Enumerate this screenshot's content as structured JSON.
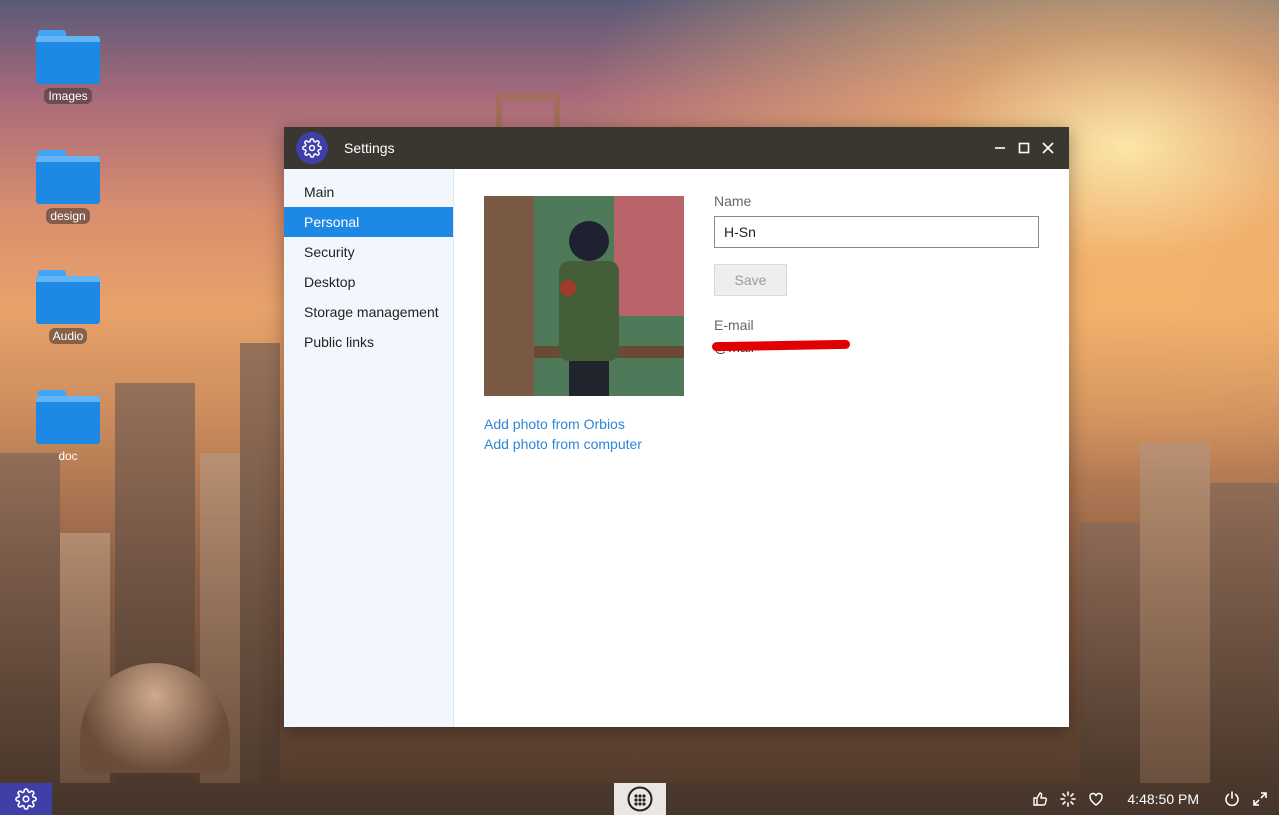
{
  "desktop": {
    "icons": [
      {
        "label": "Images"
      },
      {
        "label": "design"
      },
      {
        "label": "Audio"
      },
      {
        "label": "doc"
      }
    ]
  },
  "window": {
    "title": "Settings",
    "icon": "gear-icon",
    "controls": [
      "minimize-icon",
      "maximize-icon",
      "close-icon"
    ]
  },
  "sidebar": {
    "items": [
      {
        "label": "Main",
        "active": false
      },
      {
        "label": "Personal",
        "active": true
      },
      {
        "label": "Security",
        "active": false
      },
      {
        "label": "Desktop",
        "active": false
      },
      {
        "label": "Storage management",
        "active": false
      },
      {
        "label": "Public links",
        "active": false
      }
    ]
  },
  "profile": {
    "add_photo_orbios": "Add photo from Orbios",
    "add_photo_computer": "Add photo from computer",
    "name_label": "Name",
    "name_value": "H-Sn",
    "save_label": "Save",
    "email_label": "E-mail",
    "email_value": "@mail"
  },
  "taskbar": {
    "clock": "4:48:50 PM",
    "tray_icons": [
      "thumbs-up-icon",
      "spinner-icon",
      "heart-icon"
    ],
    "accent": "#3f3fa8"
  },
  "colors": {
    "accent": "#1e88e5",
    "link": "#2f86d6",
    "titlebar": "#3a3630"
  }
}
